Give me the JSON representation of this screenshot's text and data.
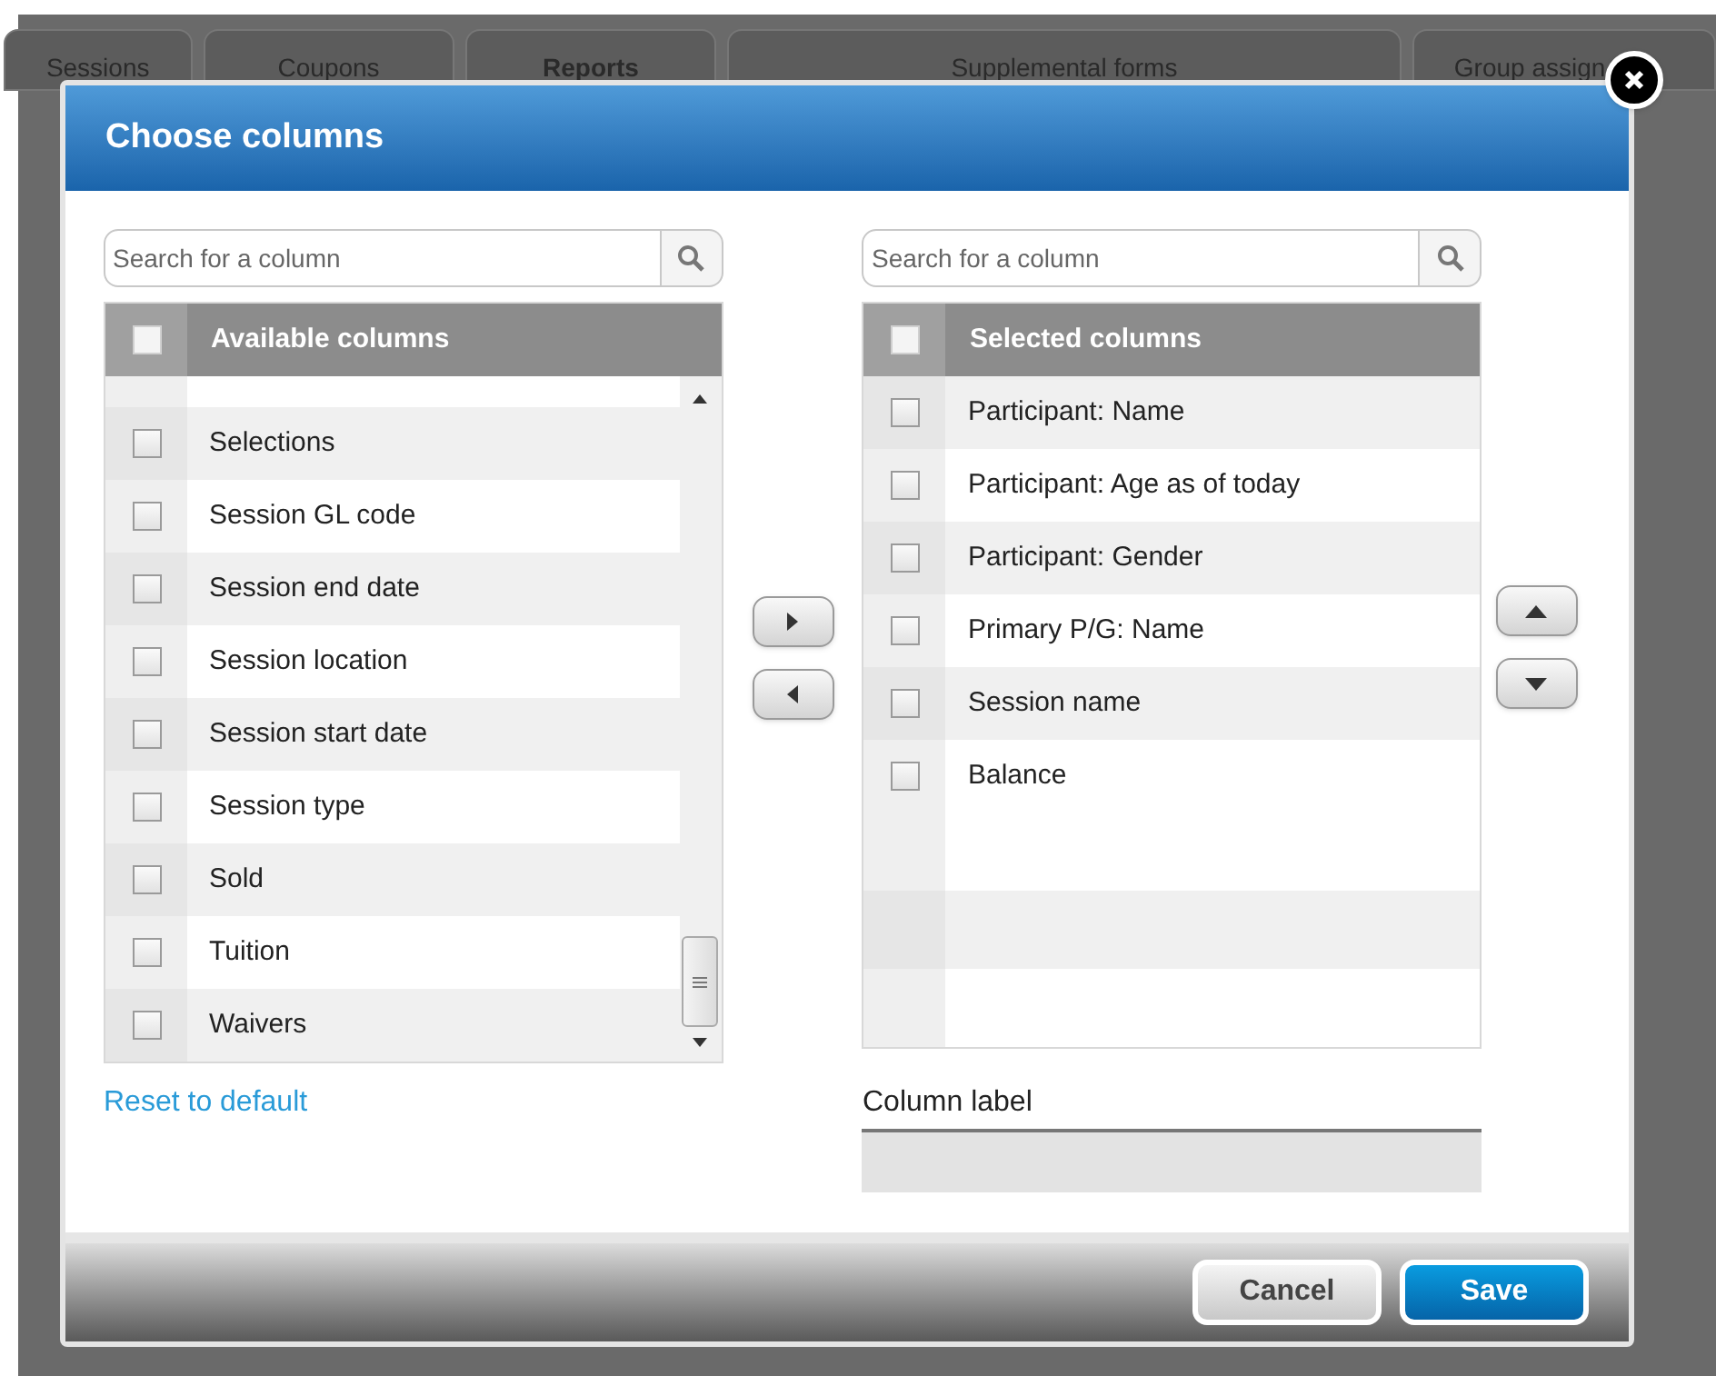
{
  "background_tabs": [
    {
      "label": "Sessions",
      "selected": false
    },
    {
      "label": "Coupons",
      "selected": false
    },
    {
      "label": "Reports",
      "selected": true
    },
    {
      "label": "Supplemental forms",
      "selected": false
    },
    {
      "label": "Group assign",
      "selected": false
    }
  ],
  "dialog": {
    "title": "Choose columns"
  },
  "available": {
    "search_placeholder": "Search for a column",
    "header": "Available columns",
    "header_checked": false,
    "items": [
      {
        "label": "Selections",
        "checked": false
      },
      {
        "label": "Session GL code",
        "checked": false
      },
      {
        "label": "Session end date",
        "checked": false
      },
      {
        "label": "Session location",
        "checked": false
      },
      {
        "label": "Session start date",
        "checked": false
      },
      {
        "label": "Session type",
        "checked": false
      },
      {
        "label": "Sold",
        "checked": false
      },
      {
        "label": "Tuition",
        "checked": false
      },
      {
        "label": "Waivers",
        "checked": false
      }
    ],
    "reset_link": "Reset to default"
  },
  "selected": {
    "search_placeholder": "Search for a column",
    "header": "Selected columns",
    "header_checked": false,
    "items": [
      {
        "label": "Participant: Name",
        "checked": false
      },
      {
        "label": "Participant: Age as of today",
        "checked": false
      },
      {
        "label": "Participant: Gender",
        "checked": false
      },
      {
        "label": "Primary P/G: Name",
        "checked": false
      },
      {
        "label": "Session name",
        "checked": false
      },
      {
        "label": "Balance",
        "checked": false
      }
    ],
    "column_label": "Column label"
  },
  "buttons": [
    {
      "label": "Cancel",
      "kind": "secondary"
    },
    {
      "label": "Save",
      "kind": "primary"
    }
  ]
}
